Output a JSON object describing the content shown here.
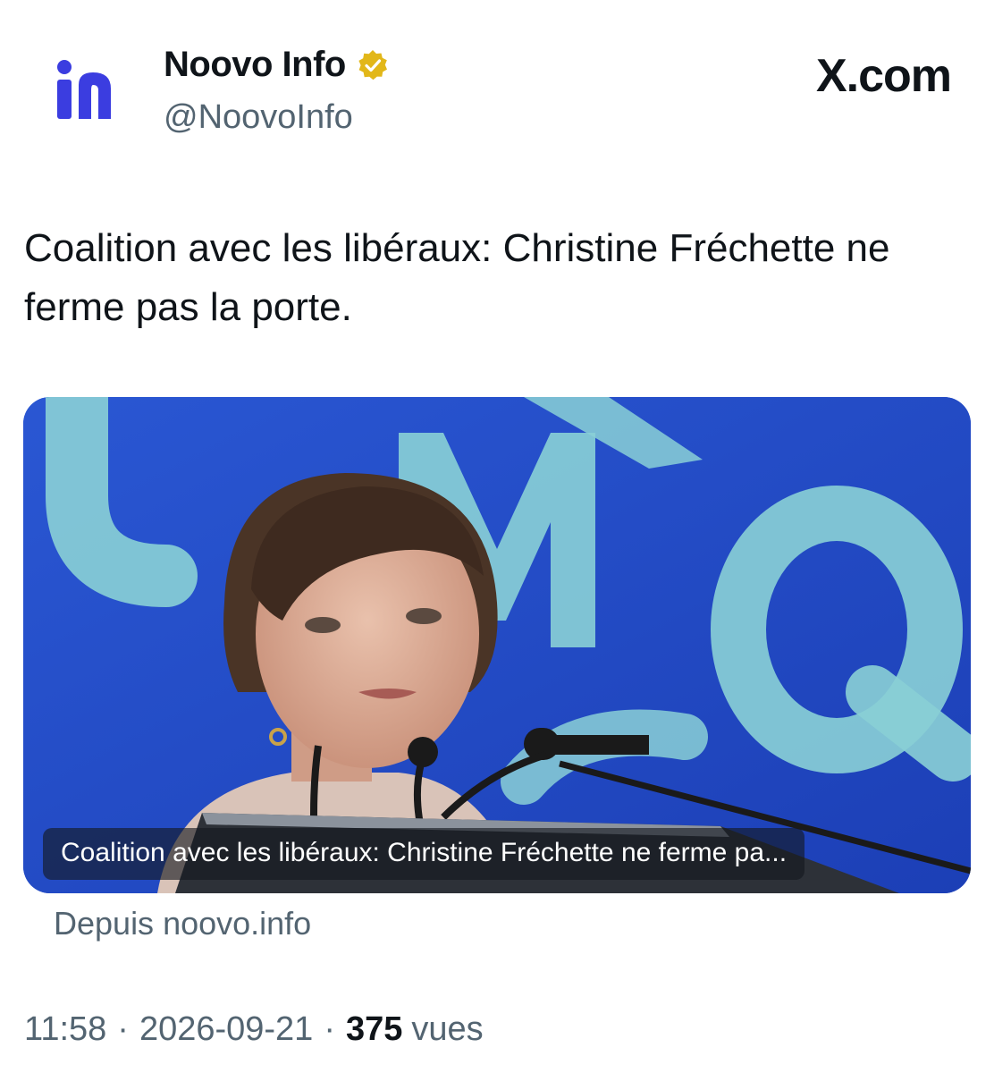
{
  "account": {
    "display_name": "Noovo Info",
    "handle": "@NoovoInfo",
    "verified_badge": "verified-gold-badge-icon",
    "avatar": "noovo-logo-icon",
    "brand_color": "#3b3de0",
    "badge_color": "#e2b719"
  },
  "source_label": "X.com",
  "tweet": {
    "text": "Coalition avec les libéraux: Christine Fréchette ne ferme pas la porte."
  },
  "link_card": {
    "caption": "Coalition avec les libéraux: Christine Fréchette ne ferme pa...",
    "photo": "woman-speaking-at-podium-photo",
    "background_color": "#1f49c6",
    "logo_color": "#8ad0d6",
    "from_label": "Depuis noovo.info"
  },
  "meta": {
    "time": "11:58",
    "separator": "·",
    "date": "2026-09-21",
    "views_count": "375",
    "views_label": "vues"
  }
}
